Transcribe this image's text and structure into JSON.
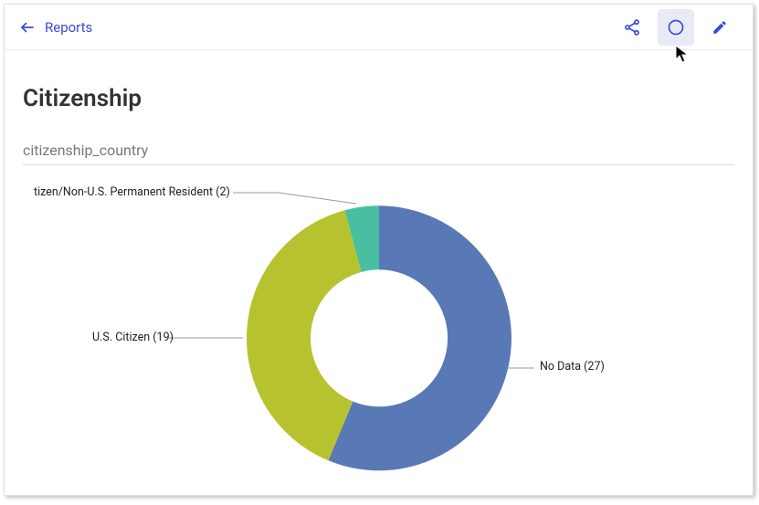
{
  "nav": {
    "back_label": "Reports"
  },
  "page": {
    "title": "Citizenship",
    "field": "citizenship_country"
  },
  "colors": {
    "primary": "#3949d8",
    "slice_nodata": "#5878b6",
    "slice_citizen": "#b6c32f",
    "slice_resident": "#47bfa0"
  },
  "chart_data": {
    "type": "pie",
    "title": "citizenship_country",
    "series": [
      {
        "name": "No Data",
        "value": 27,
        "label": "No Data (27)"
      },
      {
        "name": "U.S. Citizen",
        "value": 19,
        "label": "U.S. Citizen (19)"
      },
      {
        "name": "tizen/Non-U.S. Permanent Resident",
        "value": 2,
        "label": "tizen/Non-U.S. Permanent Resident (2)"
      }
    ],
    "donut": true
  }
}
